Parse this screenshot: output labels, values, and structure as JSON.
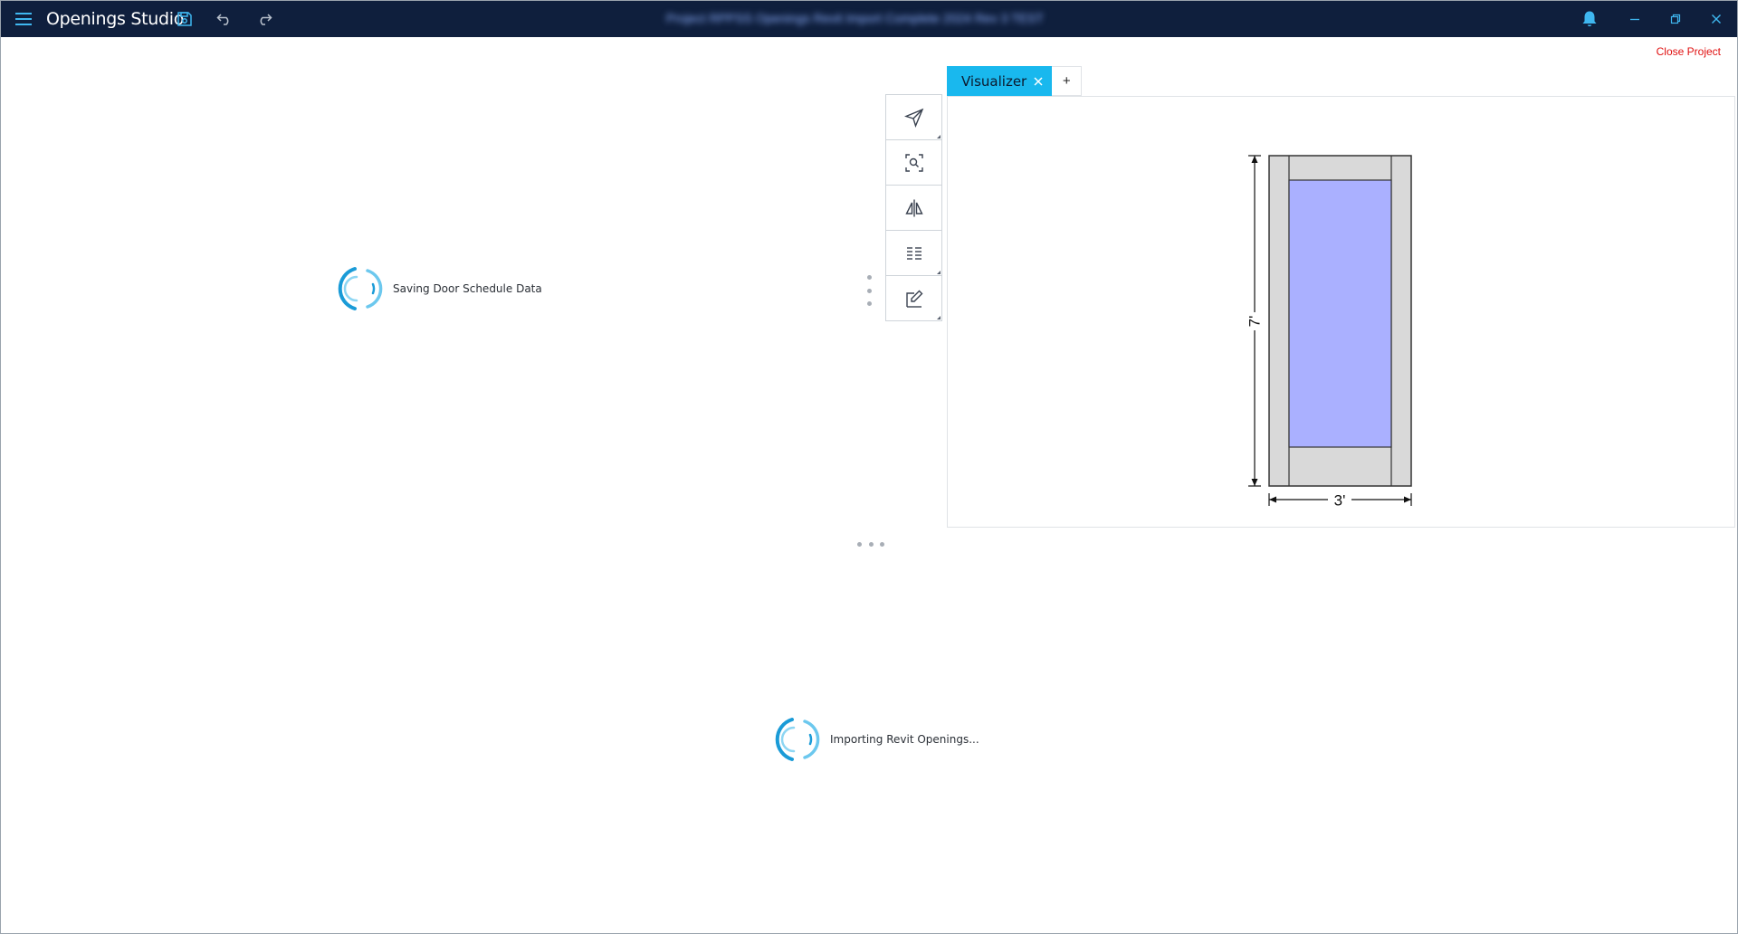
{
  "app": {
    "title": "Openings Studio",
    "project_name": "Project RPPSS Openings Revit Import Complete 2024 Rev 3 TEST"
  },
  "header": {
    "close_project_label": "Close Project"
  },
  "icons": {
    "menu": "hamburger-menu-icon",
    "save": "save-icon",
    "undo": "undo-icon",
    "redo": "redo-icon",
    "notifications": "bell-icon",
    "minimize": "minimize-icon",
    "restore": "restore-icon",
    "close": "close-icon"
  },
  "loaders": {
    "schedule": "Saving Door Schedule Data",
    "import": "Importing Revit Openings..."
  },
  "toolbar": {
    "tools": [
      {
        "name": "select-tool",
        "icon": "navigation-arrow-icon"
      },
      {
        "name": "zoom-fit-tool",
        "icon": "zoom-search-icon"
      },
      {
        "name": "mirror-tool",
        "icon": "mirror-flip-icon"
      },
      {
        "name": "list-tool",
        "icon": "list-icon"
      },
      {
        "name": "edit-tool",
        "icon": "edit-pencil-icon"
      }
    ]
  },
  "tabs": {
    "active_label": "Visualizer",
    "add_label": "+"
  },
  "visualizer": {
    "height_label": "7'",
    "width_label": "3'",
    "glass_color": "#aab0ff",
    "frame_color": "#d9d9d9"
  },
  "colors": {
    "titlebar": "#0f1f3d",
    "accent": "#19b8ee",
    "spinner": "#1a9bd7",
    "close_project": "#e01010"
  }
}
